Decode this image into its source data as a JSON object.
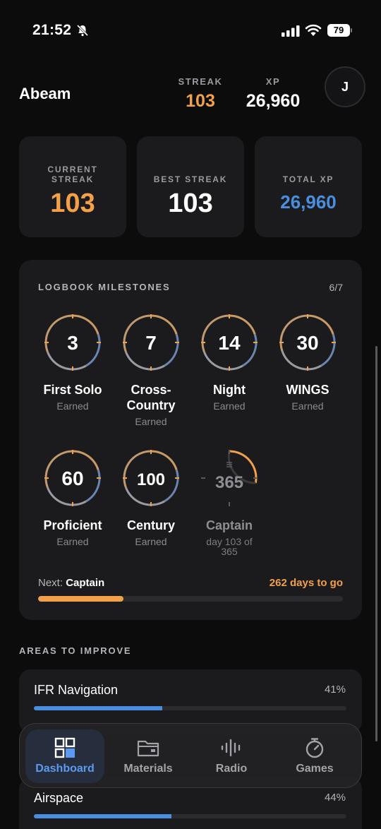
{
  "status": {
    "time": "21:52",
    "battery": "79"
  },
  "header": {
    "title": "Abeam",
    "streak_label": "STREAK",
    "streak_value": "103",
    "xp_label": "XP",
    "xp_value": "26,960",
    "avatar_initial": "J"
  },
  "cards": [
    {
      "label": "CURRENT STREAK",
      "value": "103"
    },
    {
      "label": "BEST STREAK",
      "value": "103"
    },
    {
      "label": "TOTAL XP",
      "value": "26,960"
    }
  ],
  "milestones": {
    "title": "LOGBOOK MILESTONES",
    "count": "6/7",
    "items": [
      {
        "days": "3",
        "name": "First Solo",
        "status": "Earned"
      },
      {
        "days": "7",
        "name": "Cross-Country",
        "status": "Earned"
      },
      {
        "days": "14",
        "name": "Night",
        "status": "Earned"
      },
      {
        "days": "30",
        "name": "WINGS",
        "status": "Earned"
      },
      {
        "days": "60",
        "name": "Proficient",
        "status": "Earned"
      },
      {
        "days": "100",
        "name": "Century",
        "status": "Earned"
      },
      {
        "days": "365",
        "name": "Captain",
        "status": "day 103 of 365",
        "locked": true
      }
    ],
    "next_label": "Next:",
    "next_name": "Captain",
    "days_to_go": "262 days to go",
    "progress": 0.28
  },
  "areas": {
    "title": "AREAS TO IMPROVE",
    "items": [
      {
        "name": "IFR Navigation",
        "percent": "41%",
        "value": 0.41
      },
      {
        "name": "Airspace",
        "percent": "44%",
        "value": 0.44
      }
    ]
  },
  "tabs": [
    {
      "label": "Dashboard",
      "icon": "dashboard-icon",
      "active": true
    },
    {
      "label": "Materials",
      "icon": "folder-icon"
    },
    {
      "label": "Radio",
      "icon": "radio-waveform-icon"
    },
    {
      "label": "Games",
      "icon": "stopwatch-icon"
    }
  ],
  "colors": {
    "orange": "#f2a04a",
    "blue": "#4a8ee0",
    "card": "#1b1b1d",
    "background": "#0c0c0d"
  }
}
